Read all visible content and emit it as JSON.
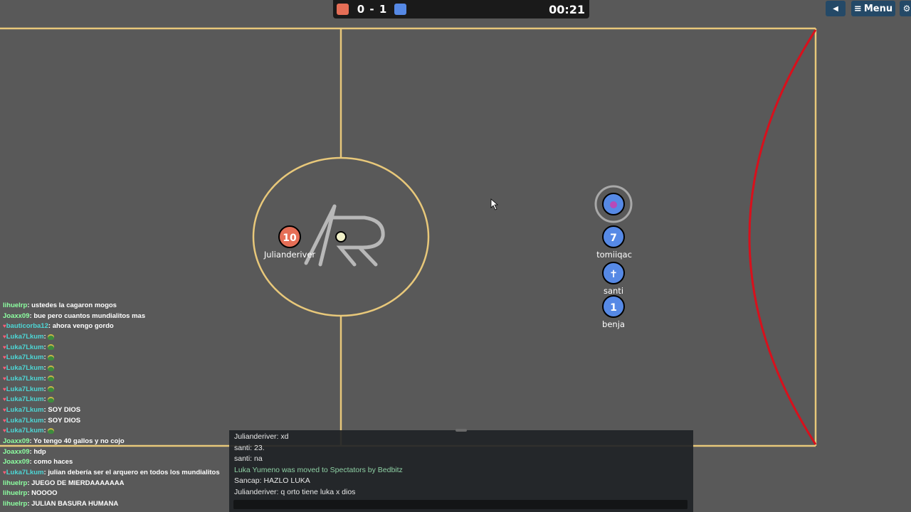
{
  "score": {
    "red": "0",
    "separator": "-",
    "blue": "1",
    "timer": "00:21"
  },
  "colors": {
    "red_team": "#e56e56",
    "blue_team": "#5689e5",
    "field": "#595959",
    "lines": "#e8c87a",
    "goal_arc": "#d8101c"
  },
  "topbar": {
    "sound_icon": "speaker-icon",
    "menu_label": "Menu",
    "settings_icon": "gear-icon"
  },
  "players": [
    {
      "team": "red",
      "avatar": "10",
      "name": "Julianderiver"
    },
    {
      "team": "blue",
      "avatar": "",
      "name": ""
    },
    {
      "team": "blue",
      "avatar": "7",
      "name": "tomiiqac"
    },
    {
      "team": "blue",
      "avatar": "✝",
      "name": "santi"
    },
    {
      "team": "blue",
      "avatar": "1",
      "name": "benja"
    }
  ],
  "chatlog": [
    {
      "heart": false,
      "name": "lihuelrp",
      "color": "green",
      "text": "ustedes la cagaron mogos"
    },
    {
      "heart": false,
      "name": "Joaxx09",
      "color": "green",
      "text": "bue pero cuantos mundialitos mas"
    },
    {
      "heart": true,
      "name": "bauticorba12",
      "color": "teal",
      "text": "ahora vengo gordo"
    },
    {
      "heart": true,
      "name": "Luka7Lkum",
      "color": "teal",
      "text": "",
      "emoji": true
    },
    {
      "heart": true,
      "name": "Luka7Lkum",
      "color": "teal",
      "text": "",
      "emoji": true
    },
    {
      "heart": true,
      "name": "Luka7Lkum",
      "color": "teal",
      "text": "",
      "emoji": true
    },
    {
      "heart": true,
      "name": "Luka7Lkum",
      "color": "teal",
      "text": "",
      "emoji": true
    },
    {
      "heart": true,
      "name": "Luka7Lkum",
      "color": "teal",
      "text": "",
      "emoji": true
    },
    {
      "heart": true,
      "name": "Luka7Lkum",
      "color": "teal",
      "text": "",
      "emoji": true
    },
    {
      "heart": true,
      "name": "Luka7Lkum",
      "color": "teal",
      "text": "",
      "emoji": true
    },
    {
      "heart": true,
      "name": "Luka7Lkum",
      "color": "teal",
      "text": "SOY DIOS"
    },
    {
      "heart": true,
      "name": "Luka7Lkum",
      "color": "teal",
      "text": "SOY DIOS"
    },
    {
      "heart": true,
      "name": "Luka7Lkum",
      "color": "teal",
      "text": "",
      "emoji": true
    },
    {
      "heart": false,
      "name": "Joaxx09",
      "color": "green",
      "text": "Yo tengo 40 gallos y no cojo"
    },
    {
      "heart": false,
      "name": "Joaxx09",
      "color": "green",
      "text": "hdp"
    },
    {
      "heart": false,
      "name": "Joaxx09",
      "color": "green",
      "text": "como haces"
    },
    {
      "heart": true,
      "name": "Luka7Lkum",
      "color": "teal",
      "text": "julian debería ser el arquero en todos los mundialitos"
    },
    {
      "heart": false,
      "name": "lihuelrp",
      "color": "green",
      "text": "JUEGO DE MIERDAAAAAAA"
    },
    {
      "heart": false,
      "name": "lihuelrp",
      "color": "green",
      "text": "NOOOO"
    },
    {
      "heart": false,
      "name": "lihuelrp",
      "color": "green",
      "text": "JULIAN BASURA HUMANA"
    }
  ],
  "chatbox": {
    "messages": [
      {
        "text": "Julianderiver: xd",
        "notice": false
      },
      {
        "text": "santi: 23.",
        "notice": false
      },
      {
        "text": "santi: na",
        "notice": false
      },
      {
        "text": "Luka Yumeno was moved to Spectators by Bedbitz",
        "notice": true
      },
      {
        "text": "Sancap: HAZLO LUKA",
        "notice": false
      },
      {
        "text": "Julianderiver: q orto tiene luka x dios",
        "notice": false
      }
    ],
    "input_value": ""
  }
}
